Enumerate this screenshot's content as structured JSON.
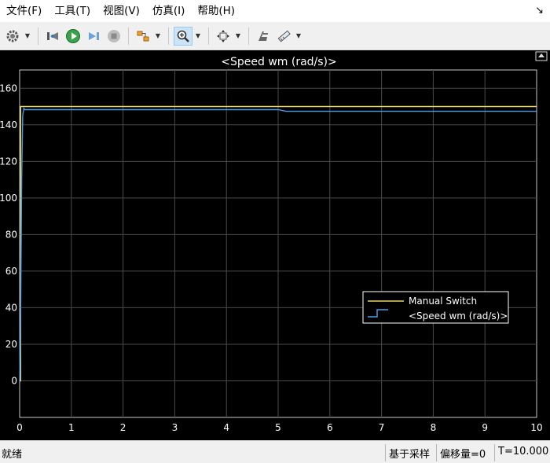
{
  "menu": [
    {
      "id": "file",
      "label": "文件(F)"
    },
    {
      "id": "tools",
      "label": "工具(T)"
    },
    {
      "id": "view",
      "label": "视图(V)"
    },
    {
      "id": "simulation",
      "label": "仿真(I)"
    },
    {
      "id": "help",
      "label": "帮助(H)"
    }
  ],
  "toolbar": {
    "icons": [
      "settings-icon",
      "step-back-icon",
      "run-icon",
      "step-forward-icon",
      "stop-icon",
      "highlight-model-icon",
      "zoom-in-icon",
      "fit-to-view-icon",
      "style-icon",
      "measurements-icon"
    ]
  },
  "plot": {
    "title": "<Speed wm (rad/s)>",
    "background": "#000000",
    "text_color": "#ffffff"
  },
  "chart_data": {
    "type": "line",
    "title": "<Speed wm (rad/s)>",
    "xlabel": "",
    "ylabel": "",
    "xlim": [
      0,
      10
    ],
    "ylim": [
      -20,
      170
    ],
    "xticks": [
      0,
      1,
      2,
      3,
      4,
      5,
      6,
      7,
      8,
      9,
      10
    ],
    "yticks": [
      0,
      20,
      40,
      60,
      80,
      100,
      120,
      140,
      160
    ],
    "grid": true,
    "legend_position": "middle-right",
    "series": [
      {
        "name": "Manual Switch",
        "color": "#e6d664",
        "style": "line",
        "x": [
          0,
          0.02,
          0.02,
          10
        ],
        "y": [
          0,
          0,
          150,
          150
        ]
      },
      {
        "name": "<Speed wm (rad/s)>",
        "color": "#4a9be8",
        "style": "line",
        "x": [
          0,
          0.02,
          0.04,
          0.06,
          0.08,
          0.1,
          5.0,
          5.15,
          10
        ],
        "y": [
          0,
          40,
          110,
          145,
          149,
          148.3,
          148.3,
          147.4,
          147.4
        ]
      }
    ]
  },
  "status": {
    "ready": "就绪",
    "sample_based": "基于采样",
    "offset": "偏移量=0",
    "time": "T=10.000"
  }
}
